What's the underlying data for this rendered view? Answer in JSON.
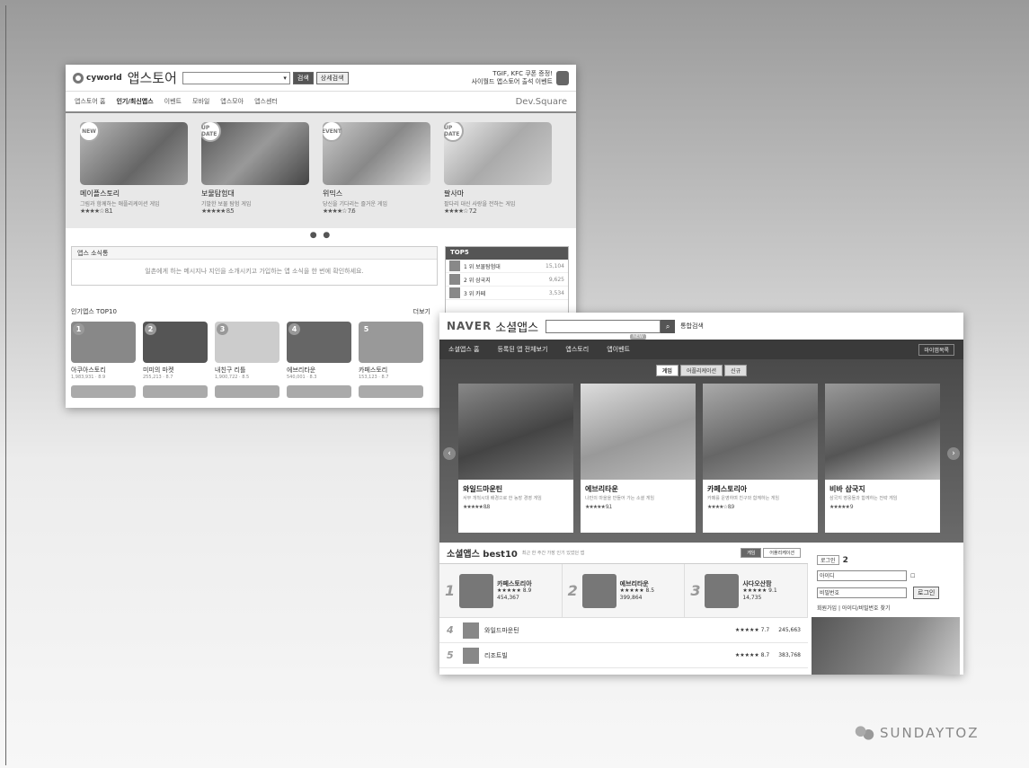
{
  "cyworld": {
    "logo_text": "cyworld",
    "logo_sub": "앱스토어",
    "search_btn": "검색",
    "advanced_btn": "상세검색",
    "promo_line1": "TGIF, KFC 쿠폰 증정!",
    "promo_line2": "사이월드 앱스토어 출석 이벤트",
    "nav": [
      "앱스토어 홈",
      "인기/최신앱스",
      "이벤트",
      "모바일",
      "앱스모아",
      "앱스센터"
    ],
    "dev_link": "Dev.Square",
    "banner": [
      {
        "badge": "NEW",
        "title": "메이플스토리",
        "desc": "그림과 함께하는 애플리케이션 게임",
        "rating": "★★★★☆ 8.1"
      },
      {
        "badge": "UP DATE",
        "title": "보물탐험대",
        "desc": "기발한 보물 탐험 게임",
        "rating": "★★★★★ 8.5"
      },
      {
        "badge": "EVENT",
        "title": "위믹스",
        "desc": "당신을 기다리는 즐거운 게임",
        "rating": "★★★★☆ 7.6"
      },
      {
        "badge": "UP DATE",
        "title": "팔사마",
        "desc": "팔다리 대신 사랑을 전하는 게임",
        "rating": "★★★★☆ 7.2"
      }
    ],
    "dots": "● ●",
    "notice_title": "앱스 소식통",
    "notice_body": "일촌에게 하는 메시지나 지인을 소개시키고 가입하는 앱 소식을 한 번에 확인하세요.",
    "side_title": "TOP5",
    "side_items": [
      {
        "name": "1 위 보물탐험대",
        "count": "15,104"
      },
      {
        "name": "2 위 삼국지",
        "count": "9,625"
      },
      {
        "name": "3 위 카페",
        "count": "3,534"
      }
    ],
    "top10_title": "인기앱스 TOP10",
    "top10_more": "더보기",
    "top10": [
      {
        "rank": "1",
        "name": "아쿠아스토리",
        "meta": "1,983,931 · 8.9"
      },
      {
        "rank": "2",
        "name": "미미의 마켓",
        "meta": "255,213 · 8.7"
      },
      {
        "rank": "3",
        "name": "내친구 리틀",
        "meta": "1,900,722 · 8.5"
      },
      {
        "rank": "4",
        "name": "에브리타운",
        "meta": "540,001 · 8.3"
      },
      {
        "rank": "5",
        "name": "카페스토리",
        "meta": "153,123 · 8.7"
      }
    ]
  },
  "naver": {
    "logo": "NAVER",
    "title": "소셜앱스",
    "search_btn": "검색",
    "advanced": "통합검색",
    "nav": [
      "소셜앱스 홈",
      "등록된 앱 전체보기",
      "앱스토리",
      "앱이벤트"
    ],
    "nav_new": "NEW",
    "nav_right": "마이앱목록",
    "tabs": [
      "게임",
      "어플리케이션",
      "신규"
    ],
    "cards": [
      {
        "title": "와일드마운틴",
        "desc": "서부 개척시대 배경으로 한 농장 경영 게임",
        "rating": "★★★★★ 8.8"
      },
      {
        "title": "에브리타운",
        "desc": "나만의 마을을 만들어 가는 소셜 게임",
        "rating": "★★★★★ 9.1"
      },
      {
        "title": "카페스토리아",
        "desc": "카페를 운영하며 친구와 함께하는 게임",
        "rating": "★★★★☆ 8.9"
      },
      {
        "title": "비바 삼국지",
        "desc": "삼국지 영웅들과 함께하는 전략 게임",
        "rating": "★★★★★ 9"
      }
    ],
    "best_title": "소셜앱스 best10",
    "best_sub": "최근 한 주간 가장 인기 있었던 앱",
    "best_tabs": [
      "게임",
      "어플리케이션"
    ],
    "top3": [
      {
        "rank": "1",
        "name": "카페스토리아",
        "rating": "★★★★★ 8.9",
        "users": "454,367"
      },
      {
        "rank": "2",
        "name": "에브리타운",
        "rating": "★★★★★ 8.5",
        "users": "399,864"
      },
      {
        "rank": "3",
        "name": "사다오산팜",
        "rating": "★★★★★ 9.1",
        "users": "14,735"
      }
    ],
    "rows": [
      {
        "rank": "4",
        "name": "와일드마운틴",
        "rating": "★★★★★ 7.7",
        "users": "245,663"
      },
      {
        "rank": "5",
        "name": "리조트빌",
        "rating": "★★★★★ 8.7",
        "users": "383,768"
      }
    ],
    "login_label": "로그인",
    "login_step": "2",
    "id_field": "아이디",
    "pw_field": "비밀번호",
    "login_btn": "로그인",
    "login_foot": "회원가입 | 아이디/비밀번호 찾기"
  },
  "brand": "SUNDAYTOZ"
}
